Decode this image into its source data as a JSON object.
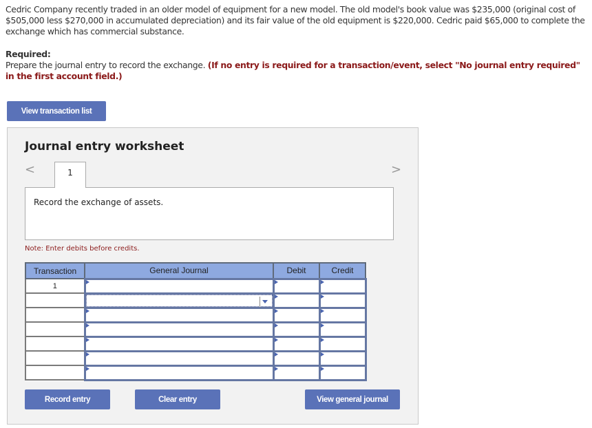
{
  "problem": {
    "text": "Cedric Company recently traded in an older model of equipment for a new model. The old model's book value was $235,000 (original cost of $505,000 less $270,000 in accumulated depreciation) and its fair value of the old equipment is $220,000. Cedric paid $65,000 to complete the exchange which has commercial substance."
  },
  "required": {
    "label": "Required:",
    "instruction": "Prepare the journal entry to record the exchange.",
    "hint": "(If no entry is required for a transaction/event, select \"No journal entry required\" in the first account field.)"
  },
  "buttons": {
    "view_transaction_list": "View transaction list",
    "record_entry": "Record entry",
    "clear_entry": "Clear entry",
    "view_general_journal": "View general journal"
  },
  "worksheet": {
    "title": "Journal entry worksheet",
    "nav_prev": "<",
    "nav_next": ">",
    "active_tab": "1",
    "description": "Record the exchange of assets.",
    "note": "Note: Enter debits before credits.",
    "table": {
      "headers": [
        "Transaction",
        "General Journal",
        "Debit",
        "Credit"
      ],
      "rows": [
        {
          "transaction": "1",
          "account": "",
          "debit": "",
          "credit": ""
        },
        {
          "transaction": "",
          "account": "",
          "debit": "",
          "credit": "",
          "focused": true
        },
        {
          "transaction": "",
          "account": "",
          "debit": "",
          "credit": ""
        },
        {
          "transaction": "",
          "account": "",
          "debit": "",
          "credit": ""
        },
        {
          "transaction": "",
          "account": "",
          "debit": "",
          "credit": ""
        },
        {
          "transaction": "",
          "account": "",
          "debit": "",
          "credit": ""
        },
        {
          "transaction": "",
          "account": "",
          "debit": "",
          "credit": ""
        }
      ]
    }
  },
  "colors": {
    "button": "#5a72b8",
    "header": "#8ea9e0",
    "hint": "#8b1a1a"
  }
}
